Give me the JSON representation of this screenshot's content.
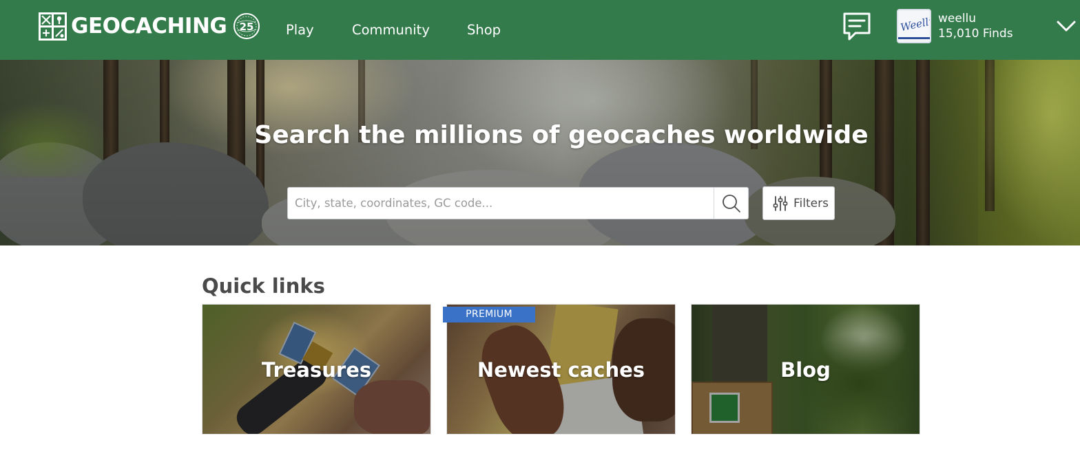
{
  "header": {
    "logo_text": "GEOCACHING",
    "anniversary_badge": "25",
    "nav": [
      {
        "label": "Play"
      },
      {
        "label": "Community"
      },
      {
        "label": "Shop"
      }
    ],
    "messages_icon": "chat-bubble-icon",
    "user": {
      "name": "weellu",
      "finds": "15,010 Finds",
      "avatar_text": "Weellu"
    },
    "menu_icon": "chevron-down-icon"
  },
  "hero": {
    "title": "Search the millions of geocaches worldwide",
    "search": {
      "placeholder": "City, state, coordinates, GC code...",
      "value": "",
      "button_icon": "search-icon"
    },
    "filters": {
      "label": "Filters",
      "icon": "sliders-icon"
    }
  },
  "quick_links": {
    "title": "Quick links",
    "cards": [
      {
        "label": "Treasures",
        "badge": ""
      },
      {
        "label": "Newest caches",
        "badge": "PREMIUM"
      },
      {
        "label": "Blog",
        "badge": ""
      }
    ]
  },
  "colors": {
    "header_green": "#347b4b",
    "premium_blue": "#3a72c8",
    "text_gray": "#4a4a4a"
  }
}
